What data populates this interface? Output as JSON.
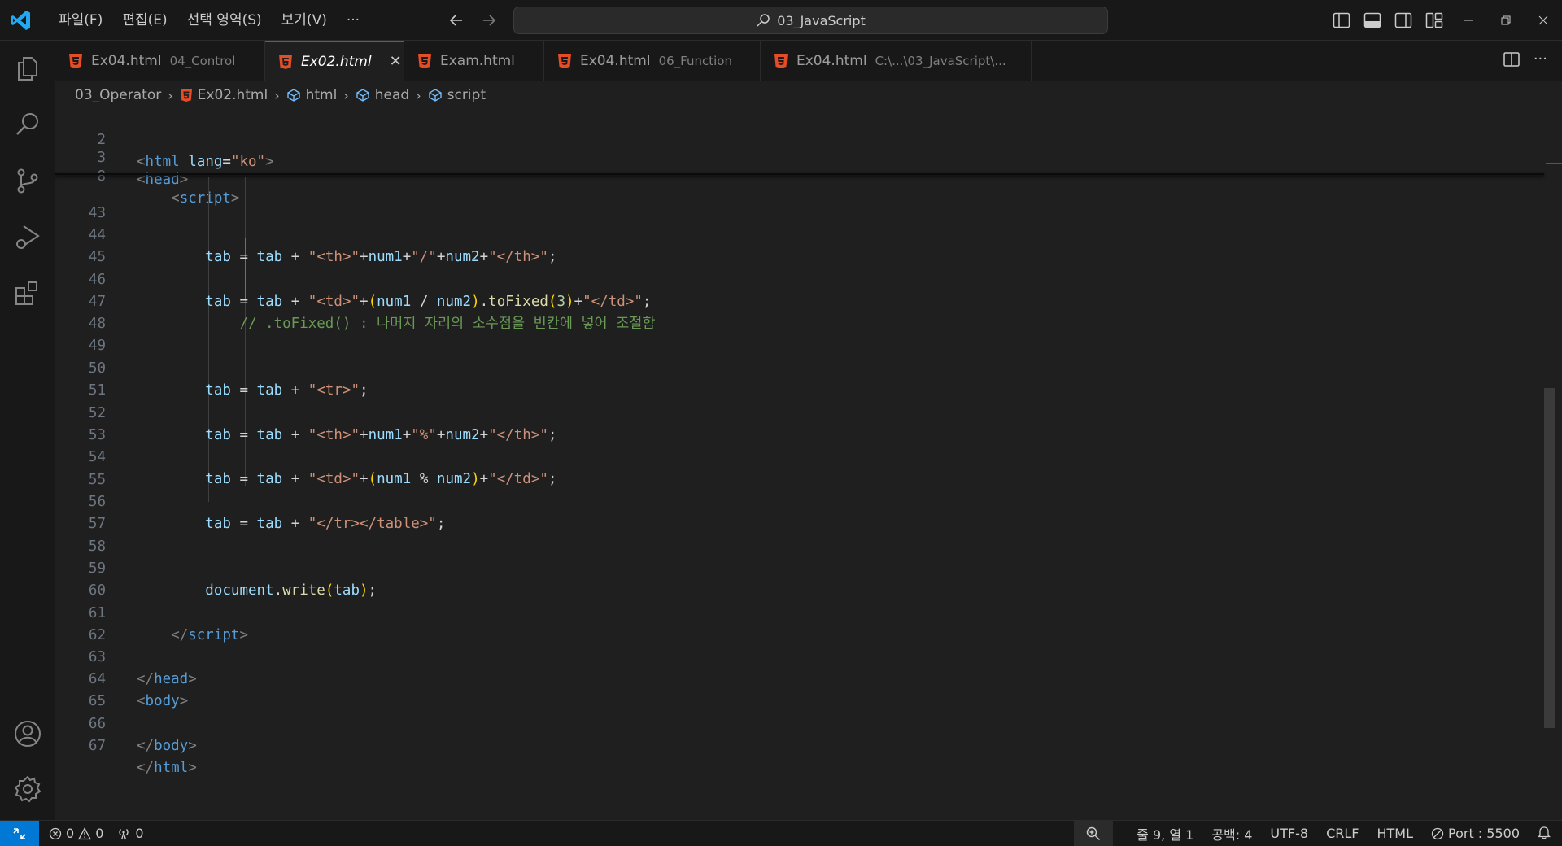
{
  "menu": {
    "items": [
      "파일(F)",
      "편집(E)",
      "선택 영역(S)",
      "보기(V)"
    ],
    "more": "···"
  },
  "search": {
    "text": "03_JavaScript"
  },
  "tabs": [
    {
      "name": "Ex04.html",
      "desc": "04_Control"
    },
    {
      "name": "Ex02.html",
      "desc": "",
      "active": true
    },
    {
      "name": "Exam.html",
      "desc": ""
    },
    {
      "name": "Ex04.html",
      "desc": "06_Function"
    },
    {
      "name": "Ex04.html",
      "desc": "C:\\...\\03_JavaScript\\..."
    }
  ],
  "breadcrumb": {
    "folder": "03_Operator",
    "file": "Ex02.html",
    "html": "html",
    "head": "head",
    "script": "script"
  },
  "sticky": [
    {
      "n": "2"
    },
    {
      "n": "3"
    },
    {
      "n": "8"
    }
  ],
  "lines": [
    "43",
    "44",
    "45",
    "46",
    "47",
    "48",
    "49",
    "50",
    "51",
    "52",
    "53",
    "54",
    "55",
    "56",
    "57",
    "58",
    "59",
    "60",
    "61",
    "62",
    "63",
    "64",
    "65",
    "66",
    "67"
  ],
  "code": {
    "html_lang_attr": "lang",
    "html_lang_val": "\"ko\"",
    "l44_str1": "\"<th>\"",
    "l44_str2": "\"/\"",
    "l44_str3": "\"</th>\"",
    "l46_str1": "\"<td>\"",
    "l46_str2": "\"</td>\"",
    "l46_num": "3",
    "l47_comment": "// .toFixed() : 나머지 자리의 소수점을 빈칸에 넣어 조절함",
    "l50_str": "\"<tr>\"",
    "l52_str1": "\"<th>\"",
    "l52_str2": "\"%\"",
    "l52_str3": "\"</th>\"",
    "l54_str1": "\"<td>\"",
    "l54_str2": "\"</td>\"",
    "l56_str": "\"</tr></table>\"",
    "var_tab": "tab",
    "var_num1": "num1",
    "var_num2": "num2",
    "fn_toFixed": "toFixed",
    "fn_write": "write",
    "obj_document": "document"
  },
  "status": {
    "errors": "0",
    "warnings": "0",
    "ports": "0",
    "position": "줄 9, 열 1",
    "spaces": "공백: 4",
    "encoding": "UTF-8",
    "eol": "CRLF",
    "language": "HTML",
    "port": "Port : 5500"
  },
  "colors": {
    "accent": "#0078d4",
    "html_icon": "#e44d26"
  }
}
